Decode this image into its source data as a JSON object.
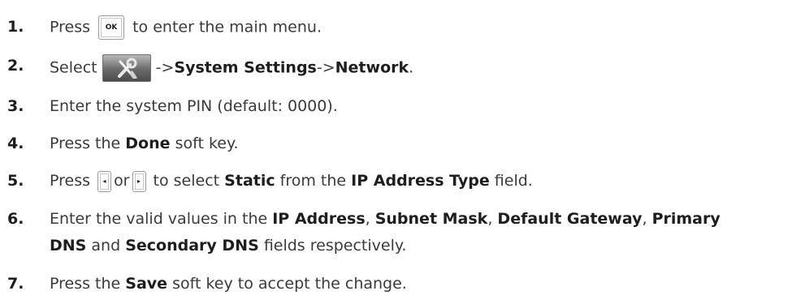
{
  "steps": [
    {
      "num": "1.",
      "parts": {
        "a": "Press",
        "key": "OK",
        "b": "to enter the main menu."
      }
    },
    {
      "num": "2.",
      "parts": {
        "a": "Select",
        "icon": "settings-wrench-screwdriver-icon",
        "b": "->",
        "c": "System Settings",
        "d": "->",
        "e": "Network",
        "f": "."
      }
    },
    {
      "num": "3.",
      "parts": {
        "a": "Enter the system PIN (default: 0000)."
      }
    },
    {
      "num": "4.",
      "parts": {
        "a": "Press the",
        "b": "Done",
        "c": "soft key."
      }
    },
    {
      "num": "5.",
      "parts": {
        "a": "Press",
        "left": "◂",
        "b": "or",
        "right": "▸",
        "c": "to select",
        "d": "Static",
        "e": "from the",
        "f": "IP Address Type",
        "g": "field."
      }
    },
    {
      "num": "6.",
      "parts": {
        "a": "Enter the valid values in the",
        "b": "IP Address",
        "c": ",",
        "d": "Subnet Mask",
        "e": ",",
        "f": "Default Gateway",
        "g": ",",
        "h": "Primary",
        "i": "DNS",
        "j": "and",
        "k": "Secondary DNS",
        "l": "fields respectively."
      }
    },
    {
      "num": "7.",
      "parts": {
        "a": "Press the",
        "b": "Save",
        "c": "soft key to accept the change."
      }
    }
  ]
}
